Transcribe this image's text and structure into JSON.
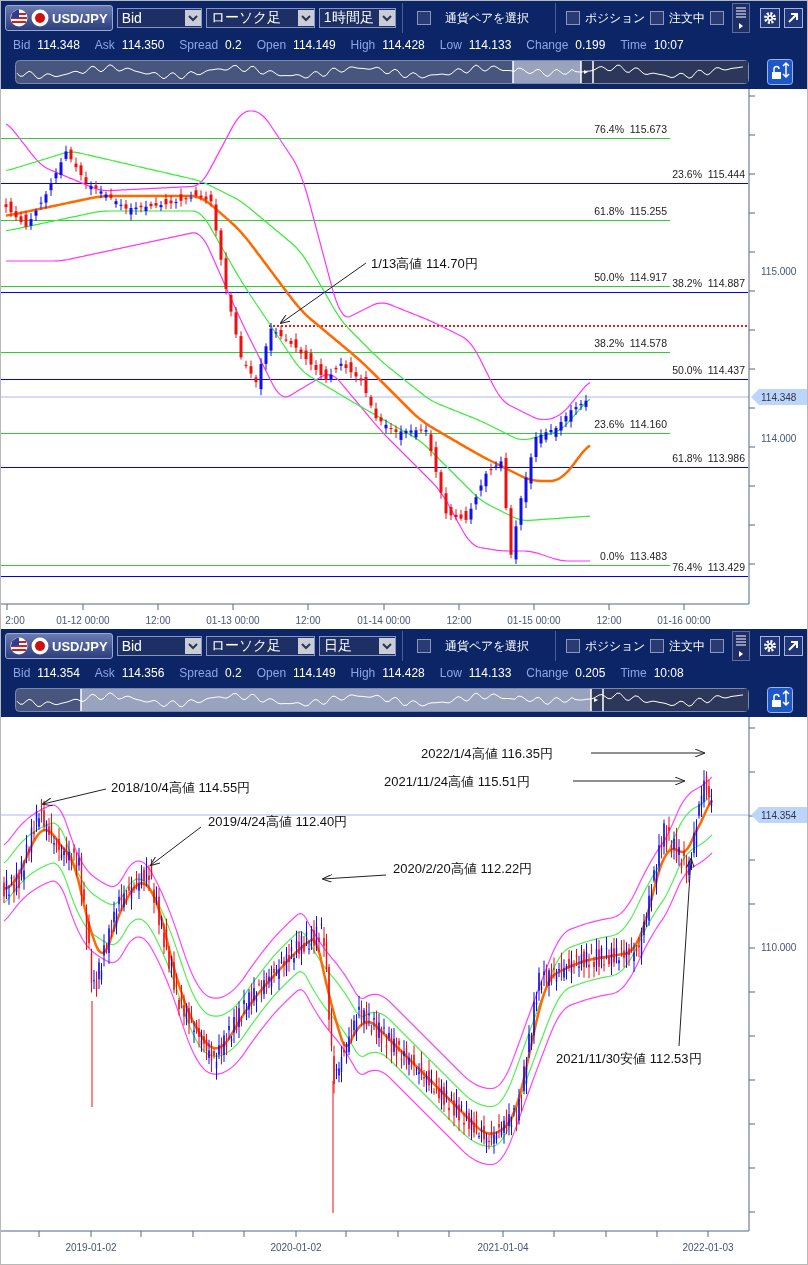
{
  "panels": [
    {
      "toolbar": {
        "pair": "USD/JPY",
        "price_type": "Bid",
        "chart_type": "ローソク足",
        "timeframe": "1時間足",
        "pair_select": {
          "label": "通貨ペアを選択",
          "checked": false
        },
        "position": {
          "label": "ポジション",
          "checked": false
        },
        "orders": {
          "label": "注文中",
          "checked": false
        },
        "extra": {
          "checked": false
        }
      },
      "quote": [
        {
          "label": "Bid",
          "value": "114.348"
        },
        {
          "label": "Ask",
          "value": "114.350"
        },
        {
          "label": "Spread",
          "value": "0.2"
        },
        {
          "label": "Open",
          "value": "114.149"
        },
        {
          "label": "High",
          "value": "114.428"
        },
        {
          "label": "Low",
          "value": "114.133"
        },
        {
          "label": "Change",
          "value": "0.199"
        },
        {
          "label": "Time",
          "value": "10:07"
        }
      ],
      "chart": {
        "y_labels": [
          "115.000",
          "114.000"
        ],
        "current_price": "114.348",
        "x_labels": [
          "2:00",
          "01-12 00:00",
          "12:00",
          "01-13 00:00",
          "12:00",
          "01-14 00:00",
          "12:00",
          "01-15 00:00",
          "12:00",
          "01-16 00:00"
        ],
        "levels": [
          {
            "ratio": "76.4%",
            "price": "115.673",
            "color": "#33cc33"
          },
          {
            "ratio": "23.6%",
            "price": "115.444",
            "color": "#0000ee"
          },
          {
            "ratio": "61.8%",
            "price": "115.255",
            "color": "#33cc33"
          },
          {
            "ratio": "50.0%",
            "price": "114.917",
            "color": "#33cc33"
          },
          {
            "ratio": "38.2%",
            "price": "114.887",
            "color": "#0000ee"
          },
          {
            "ratio": "38.2%",
            "price": "114.578",
            "color": "#33cc33"
          },
          {
            "ratio": "50.0%",
            "price": "114.437",
            "color": "#0000ee"
          },
          {
            "ratio": "23.6%",
            "price": "114.160",
            "color": "#33cc33"
          },
          {
            "ratio": "61.8%",
            "price": "113.986",
            "color": "#0000ee"
          },
          {
            "ratio": "0.0%",
            "price": "113.483",
            "color": "#33cc33"
          },
          {
            "ratio": "76.4%",
            "price": "113.429",
            "color": "#0000ee"
          }
        ],
        "annotations": [
          "1/13高値 114.70円"
        ]
      }
    },
    {
      "toolbar": {
        "pair": "USD/JPY",
        "price_type": "Bid",
        "chart_type": "ローソク足",
        "timeframe": "日足",
        "pair_select": {
          "label": "通貨ペアを選択",
          "checked": false
        },
        "position": {
          "label": "ポジション",
          "checked": false
        },
        "orders": {
          "label": "注文中",
          "checked": false
        },
        "extra": {
          "checked": false
        }
      },
      "quote": [
        {
          "label": "Bid",
          "value": "114.354"
        },
        {
          "label": "Ask",
          "value": "114.356"
        },
        {
          "label": "Spread",
          "value": "0.2"
        },
        {
          "label": "Open",
          "value": "114.149"
        },
        {
          "label": "High",
          "value": "114.428"
        },
        {
          "label": "Low",
          "value": "114.133"
        },
        {
          "label": "Change",
          "value": "0.205"
        },
        {
          "label": "Time",
          "value": "10:08"
        }
      ],
      "chart": {
        "y_labels": [
          "110.000"
        ],
        "current_price": "114.354",
        "x_labels": [
          "2019-01-02",
          "2020-01-02",
          "2021-01-04",
          "2022-01-03"
        ],
        "annotations": [
          "2022/1/4高値 116.35円",
          "2021/11/24高値 115.51円",
          "2018/10/4高値 114.55円",
          "2019/4/24高値 112.40円",
          "2020/2/20高値 112.22円",
          "2021/11/30安値 112.53円"
        ]
      }
    }
  ]
}
